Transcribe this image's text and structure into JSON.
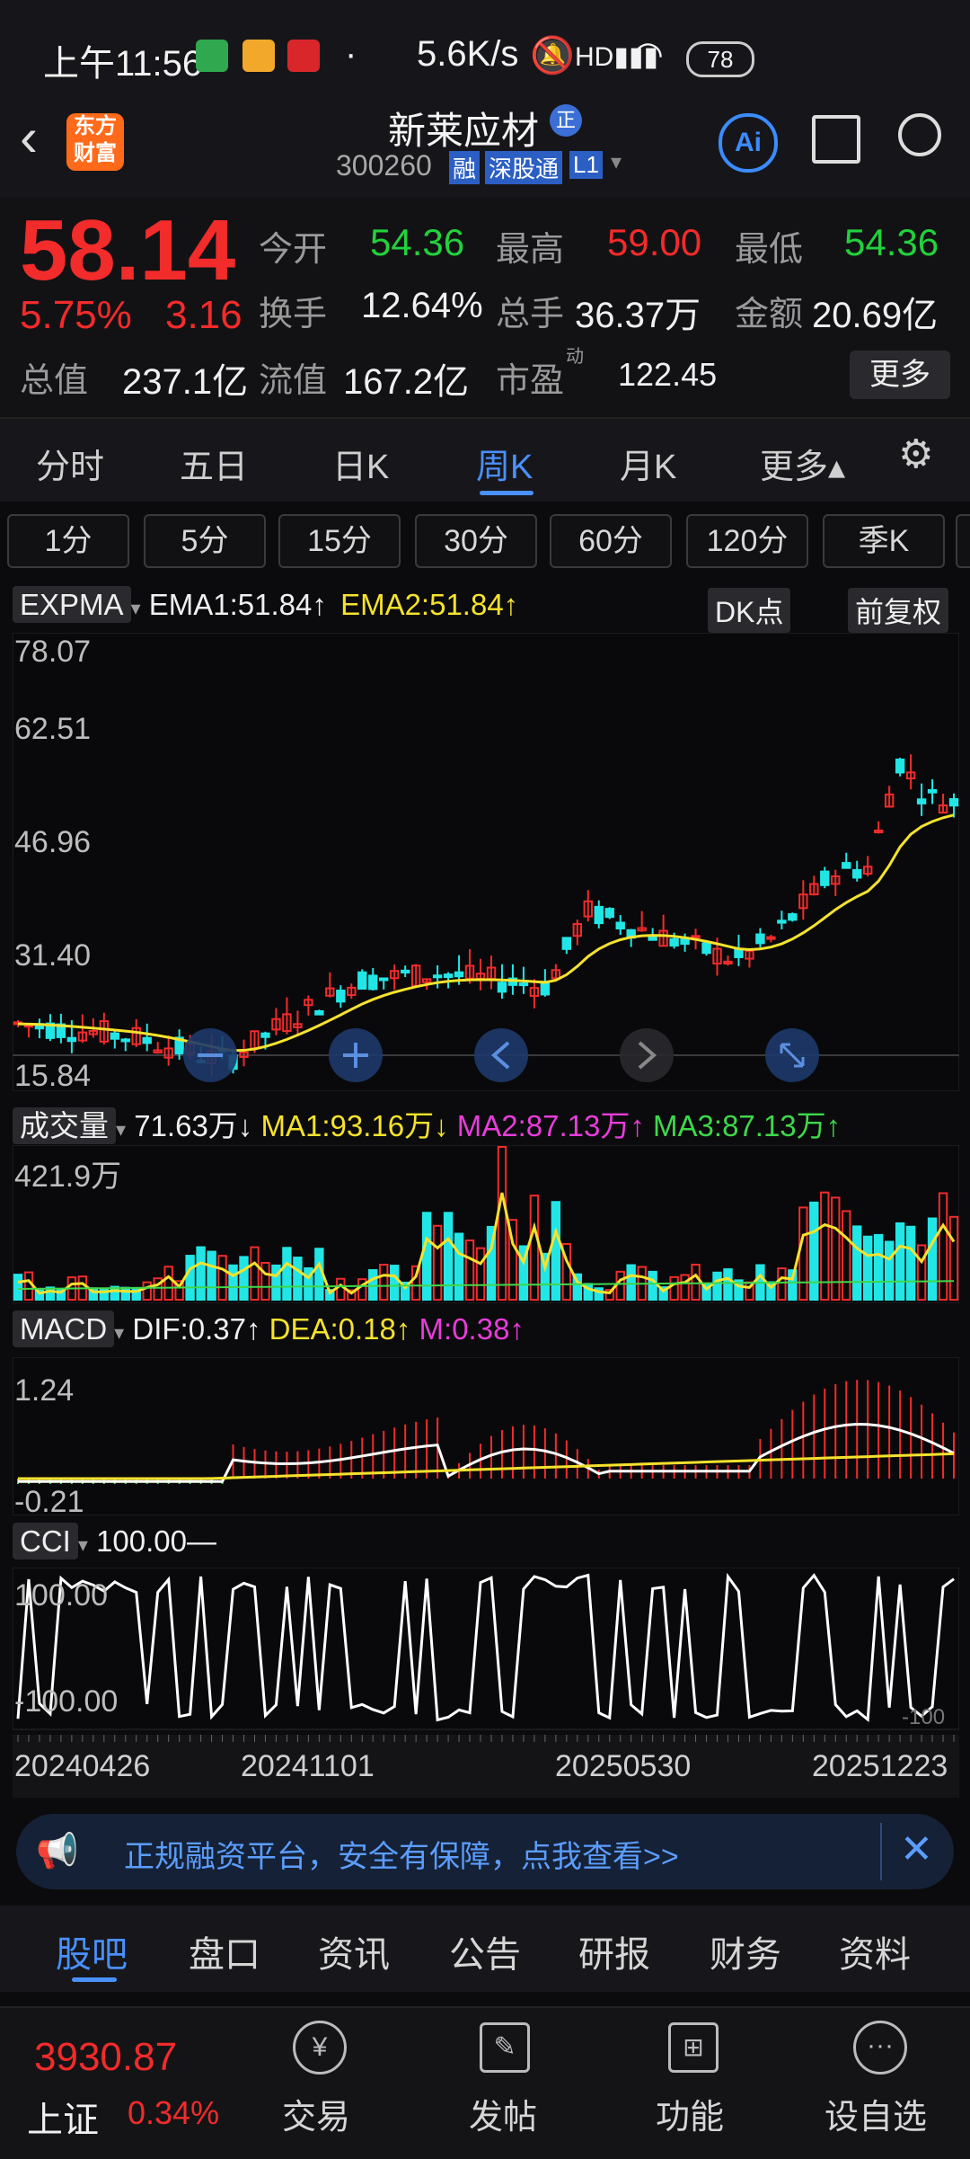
{
  "status": {
    "time": "上午11:56",
    "speed": "5.6K/s",
    "battery": "78"
  },
  "header": {
    "brand": "东方财富",
    "title": "新莱应材",
    "code": "300260",
    "badges": [
      "融",
      "深股通",
      "L1"
    ],
    "ai": "Ai"
  },
  "quote": {
    "price": "58.14",
    "pct": "5.75%",
    "chg": "3.16",
    "open_label": "今开",
    "open": "54.36",
    "high_label": "最高",
    "high": "59.00",
    "low_label": "最低",
    "low": "54.36",
    "turnover_label": "换手",
    "turnover": "12.64%",
    "vol_label": "总手",
    "vol": "36.37万",
    "amount_label": "金额",
    "amount": "20.69亿",
    "mcap_label": "总值",
    "mcap": "237.1亿",
    "float_label": "流值",
    "float": "167.2亿",
    "pe_label": "市盈",
    "pe_sup": "动",
    "pe": "122.45",
    "more": "更多"
  },
  "tabs": [
    "分时",
    "五日",
    "日K",
    "周K",
    "月K",
    "更多▴"
  ],
  "periods": [
    "1分",
    "5分",
    "15分",
    "30分",
    "60分",
    "120分",
    "季K"
  ],
  "main_legend": {
    "name": "EXPMA",
    "ema1": "EMA1:51.84↑",
    "ema2": "EMA2:51.84↑",
    "dk": "DK点",
    "fq": "前复权"
  },
  "main_axis": [
    "78.07",
    "62.51",
    "46.96",
    "31.40",
    "15.84"
  ],
  "vol_legend": {
    "name": "成交量",
    "vol": "71.63万↓",
    "ma1": "MA1:93.16万↓",
    "ma2": "MA2:87.13万↑",
    "ma3": "MA3:87.13万↑"
  },
  "vol_axis": "421.9万",
  "macd_legend": {
    "name": "MACD",
    "dif": "DIF:0.37↑",
    "dea": "DEA:0.18↑",
    "m": "M:0.38↑"
  },
  "macd_axis": [
    "1.24",
    "-0.21"
  ],
  "cci_legend": {
    "name": "CCI",
    "val": "100.00—"
  },
  "cci_axis": [
    "100.00",
    "-100.00",
    "-100"
  ],
  "dates": [
    "20240426",
    "20241101",
    "20250530",
    "20251223"
  ],
  "banner": "正规融资平台，安全有保障，点我查看>>",
  "bottom_tabs": [
    "股吧",
    "盘口",
    "资讯",
    "公告",
    "研报",
    "财务",
    "资料"
  ],
  "footer": {
    "index_value": "3930.87",
    "index_name": "上证",
    "index_pct": "0.34%",
    "items": [
      "交易",
      "发帖",
      "功能",
      "设自选"
    ]
  },
  "colors": {
    "up": "#f22b2b",
    "down": "#22e6e6",
    "ema": "#f6e22c",
    "accent": "#3b8cff"
  }
}
